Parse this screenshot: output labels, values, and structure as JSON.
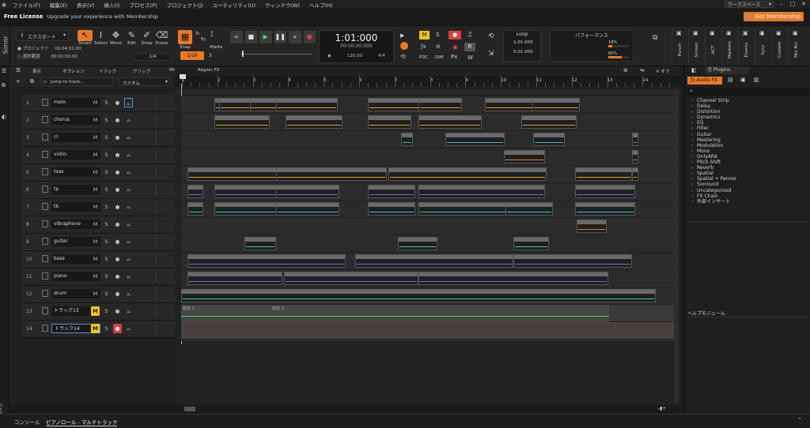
{
  "menu": [
    "ファイル(F)",
    "編集(E)",
    "表示(V)",
    "挿入(I)",
    "プロセス(P)",
    "プロジェクト(J)",
    "ユーティリティ(U)",
    "ウィンドウ(W)",
    "ヘルプ(H)"
  ],
  "workspace": "ワークスペース",
  "license": {
    "title": "Free License",
    "message": "Upgrade your experience with Membership",
    "cta": "Get Membership"
  },
  "app_name": "Sonar",
  "export": {
    "label": "エクスポート",
    "project": "プロジェクト",
    "project_time": "00:04:31:00",
    "selection": "選択範囲",
    "selection_time": "00:00:00:00"
  },
  "tools": [
    "Smart",
    "Select",
    "Move",
    "Edit",
    "Draw",
    "Erase"
  ],
  "tool_sub": "1/4",
  "snap": {
    "label": "Snap",
    "value": "1/16",
    "by": "By",
    "to": "To",
    "marks": "Marks",
    "marks_num": "3"
  },
  "transport": {
    "time": "1:01:000",
    "timecode": "00:00:00:000",
    "sub1": "120.00",
    "sub2": "4/4"
  },
  "msr": {
    "m": "M",
    "s": "S",
    "r": "R"
  },
  "pdc": [
    "PDC",
    "DIM",
    "Px"
  ],
  "loop": {
    "label": "Loop",
    "start": "1:01:000",
    "end": "5:01:000"
  },
  "perf": {
    "label": "パフォーマンス",
    "v1": "18%",
    "v2": "66%"
  },
  "vtabs": [
    "Punch",
    "Screen",
    "ACT",
    "Markers",
    "Events",
    "Sync",
    "Custom",
    "Mix Rcl"
  ],
  "trackhdr": {
    "menu": [
      "表示",
      "オプション",
      "トラック",
      "クリップ",
      "MIDI",
      "Region FX"
    ],
    "jump": "Jump to track...",
    "custom": "カスタム"
  },
  "ruler": [
    "1",
    "2",
    "3",
    "4",
    "5",
    "6",
    "7",
    "8",
    "9",
    "10",
    "11",
    "12",
    "13",
    "14"
  ],
  "tracks": [
    {
      "num": "1",
      "name": "melo"
    },
    {
      "num": "2",
      "name": "chorus"
    },
    {
      "num": "3",
      "name": "cl"
    },
    {
      "num": "4",
      "name": "violin"
    },
    {
      "num": "5",
      "name": "tsax"
    },
    {
      "num": "6",
      "name": "tp"
    },
    {
      "num": "7",
      "name": "tb"
    },
    {
      "num": "8",
      "name": "vibraphone"
    },
    {
      "num": "9",
      "name": "guiter"
    },
    {
      "num": "10",
      "name": "bass"
    },
    {
      "num": "11",
      "name": "piano"
    },
    {
      "num": "12",
      "name": "drum"
    },
    {
      "num": "13",
      "name": "トラック13"
    },
    {
      "num": "14",
      "name": "トラック14"
    }
  ],
  "clip_labels": {
    "a": "録音 1",
    "b": "録音 2"
  },
  "browser": {
    "tab": "Plugins",
    "cat": "Audio FX",
    "items": [
      "Channel Strip",
      "Delay",
      "Distortion",
      "Dynamics",
      "EQ",
      "Filter",
      "Guitar",
      "Mastering",
      "Modulation",
      "Mono",
      "OnlyARA",
      "Pitch Shift",
      "Reverb",
      "Spatial",
      "Spatial + Panner",
      "Surround",
      "Uncategorized",
      "FX Chain"
    ],
    "external": "外部インサート",
    "help": "ヘルプモジュール"
  },
  "bottom": {
    "console": "コンソール",
    "piano": "ピアノロール - マルチトラック"
  },
  "inspector": "インスペクタ",
  "colors": {
    "accent": "#e8782a",
    "mute": "#e8c420",
    "rec": "#d94040"
  }
}
